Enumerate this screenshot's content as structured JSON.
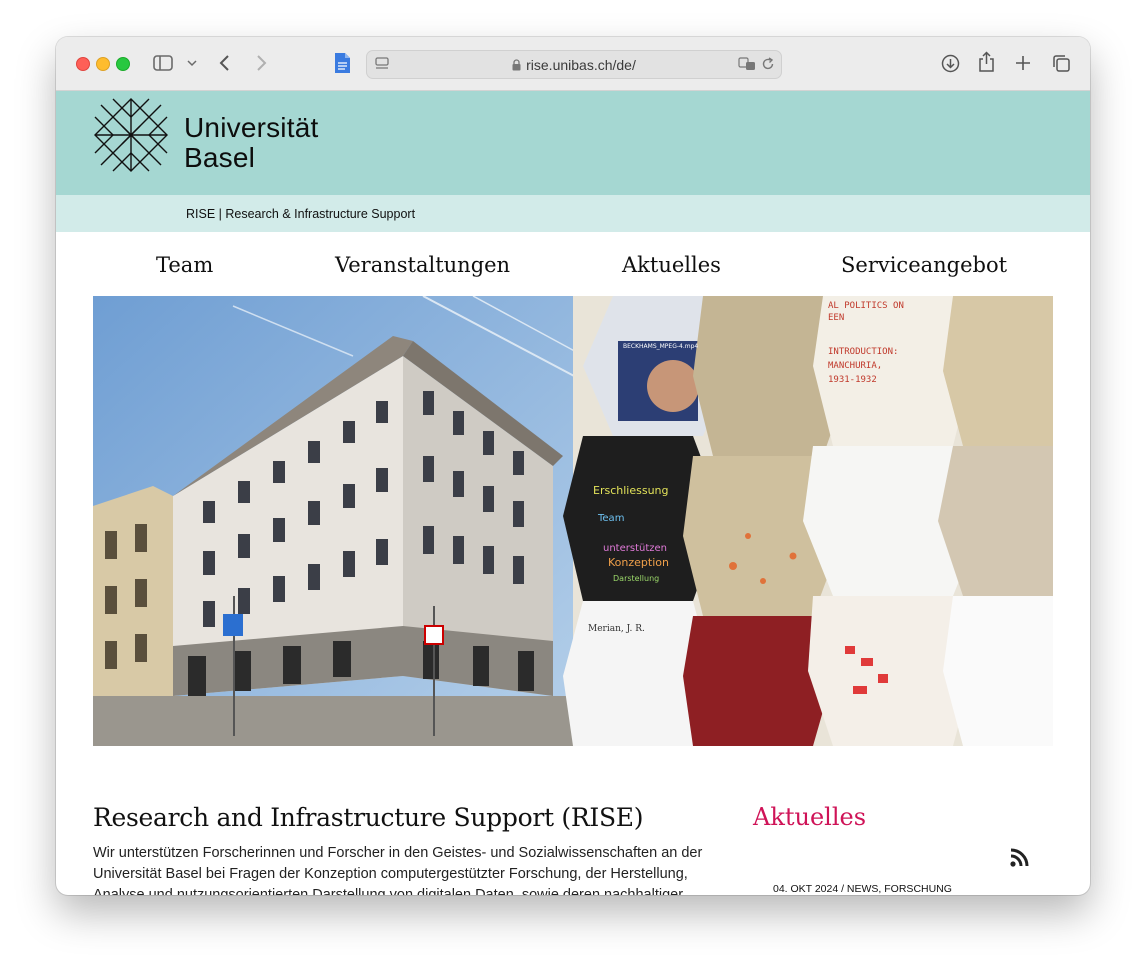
{
  "browser": {
    "url": "rise.unibas.ch/de/"
  },
  "header": {
    "logo_line1": "Universität",
    "logo_line2": "Basel",
    "subtitle": "RISE | Research & Infrastructure Support",
    "colors": {
      "band": "#a5d7d2",
      "subband": "#d2ebe9"
    }
  },
  "nav": {
    "items": [
      {
        "label": "Team"
      },
      {
        "label": "Veranstaltungen"
      },
      {
        "label": "Aktuelles"
      },
      {
        "label": "Serviceangebot"
      }
    ]
  },
  "hero": {
    "collage_title": "INTRODUCTION: MANCHURIA, 1931-1932",
    "collage_heading": "AL POLITICS ON EEN",
    "person_label": "Merian, J. R.",
    "video_label": "BECKHAMS_MPEG-4.mp4",
    "tagcloud_words": [
      "Erschliessung",
      "Team",
      "unterstützen",
      "Konzeption",
      "Darstellung"
    ]
  },
  "main": {
    "title": "Research and Infrastructure Support (RISE)",
    "intro": "Wir unterstützen Forscherinnen und Forscher in den Geistes- und Sozialwissenschaften an der Universität Basel bei Fragen der Konzeption computergestützter Forschung, der Herstellung, Analyse und nutzungsorientierten Darstellung von digitalen Daten, sowie deren nachhaltiger"
  },
  "sidebar": {
    "title": "Aktuelles",
    "accent_color": "#cf1357",
    "news": [
      {
        "meta": "04. OKT 2024 / NEWS, FORSCHUNG"
      }
    ]
  }
}
